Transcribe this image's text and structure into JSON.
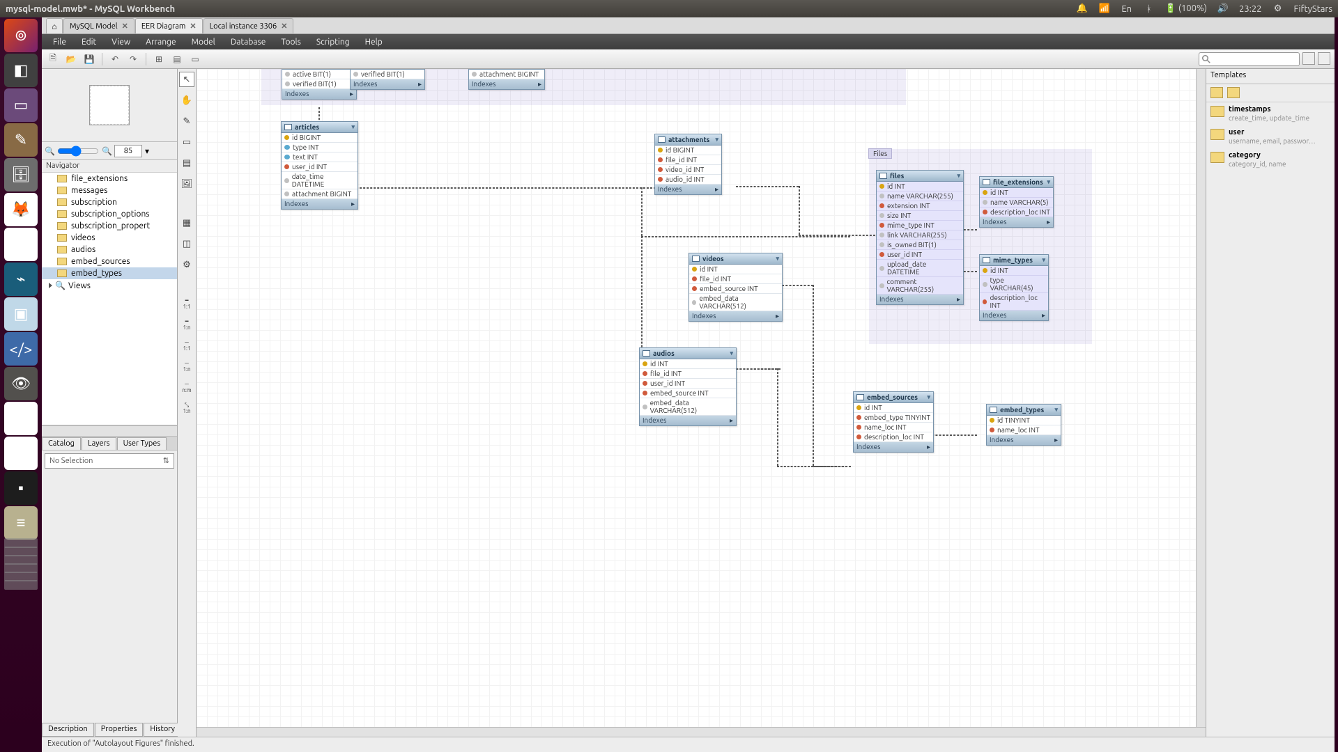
{
  "window": {
    "title": "mysql-model.mwb* - MySQL Workbench"
  },
  "panel": {
    "notif": "🔔",
    "wifi": "📶",
    "lang": "En",
    "bt": "ᚼ",
    "battery": "(100%)",
    "vol": "🔊",
    "time": "23:22",
    "gear": "⚙",
    "user": "FiftyStars"
  },
  "tabs": {
    "home": "⌂",
    "t1": "MySQL Model",
    "t2": "EER Diagram",
    "t3": "Local instance 3306"
  },
  "menu": {
    "file": "File",
    "edit": "Edit",
    "view": "View",
    "arrange": "Arrange",
    "model": "Model",
    "database": "Database",
    "tools": "Tools",
    "scripting": "Scripting",
    "help": "Help"
  },
  "nav": {
    "title": "Navigator",
    "zoom": "85",
    "items": [
      "file_extensions",
      "messages",
      "subscription",
      "subscription_options",
      "subscription_propert",
      "videos",
      "audios",
      "embed_sources",
      "embed_types"
    ],
    "views": "Views",
    "lowtabs": {
      "catalog": "Catalog",
      "layers": "Layers",
      "usertypes": "User Types"
    },
    "selection": "No Selection",
    "btabs": {
      "desc": "Description",
      "prop": "Properties",
      "hist": "History"
    }
  },
  "canvas": {
    "layer_files": "Files",
    "frag1": {
      "cols": [
        "active BIT(1)",
        "verified BIT(1)"
      ],
      "idx": "Indexes"
    },
    "frag2": {
      "cols": [
        "verified BIT(1)"
      ],
      "idx": "Indexes"
    },
    "frag3": {
      "cols": [
        "attachment BIGINT"
      ],
      "idx": "Indexes"
    },
    "articles": {
      "name": "articles",
      "cols": [
        "id BIGINT",
        "type INT",
        "text INT",
        "user_id INT",
        "date_time DATETIME",
        "attachment BIGINT"
      ],
      "idx": "Indexes"
    },
    "attachments": {
      "name": "attachments",
      "cols": [
        "id BIGINT",
        "file_id INT",
        "video_id INT",
        "audio_id INT"
      ],
      "idx": "Indexes"
    },
    "videos": {
      "name": "videos",
      "cols": [
        "id INT",
        "file_id INT",
        "embed_source INT",
        "embed_data VARCHAR(512)"
      ],
      "idx": "Indexes"
    },
    "audios": {
      "name": "audios",
      "cols": [
        "id INT",
        "file_id INT",
        "user_id INT",
        "embed_source INT",
        "embed_data VARCHAR(512)"
      ],
      "idx": "Indexes"
    },
    "files": {
      "name": "files",
      "cols": [
        "id INT",
        "name VARCHAR(255)",
        "extension INT",
        "size INT",
        "mime_type INT",
        "link VARCHAR(255)",
        "is_owned BIT(1)",
        "user_id INT",
        "upload_date DATETIME",
        "comment VARCHAR(255)"
      ],
      "idx": "Indexes"
    },
    "file_extensions": {
      "name": "file_extensions",
      "cols": [
        "id INT",
        "name VARCHAR(5)",
        "description_loc INT"
      ],
      "idx": "Indexes"
    },
    "mime_types": {
      "name": "mime_types",
      "cols": [
        "id INT",
        "type VARCHAR(45)",
        "description_loc INT"
      ],
      "idx": "Indexes"
    },
    "embed_sources": {
      "name": "embed_sources",
      "cols": [
        "id INT",
        "embed_type TINYINT",
        "name_loc INT",
        "description_loc INT"
      ],
      "idx": "Indexes"
    },
    "embed_types": {
      "name": "embed_types",
      "cols": [
        "id TINYINT",
        "name_loc INT"
      ],
      "idx": "Indexes"
    }
  },
  "templates": {
    "title": "Templates",
    "t1": {
      "n": "timestamps",
      "d": "create_time, update_time"
    },
    "t2": {
      "n": "user",
      "d": "username, email, passwor…"
    },
    "t3": {
      "n": "category",
      "d": "category_id, name"
    }
  },
  "status": "Execution of \"Autolayout Figures\" finished.",
  "idx_arrow": "▸"
}
